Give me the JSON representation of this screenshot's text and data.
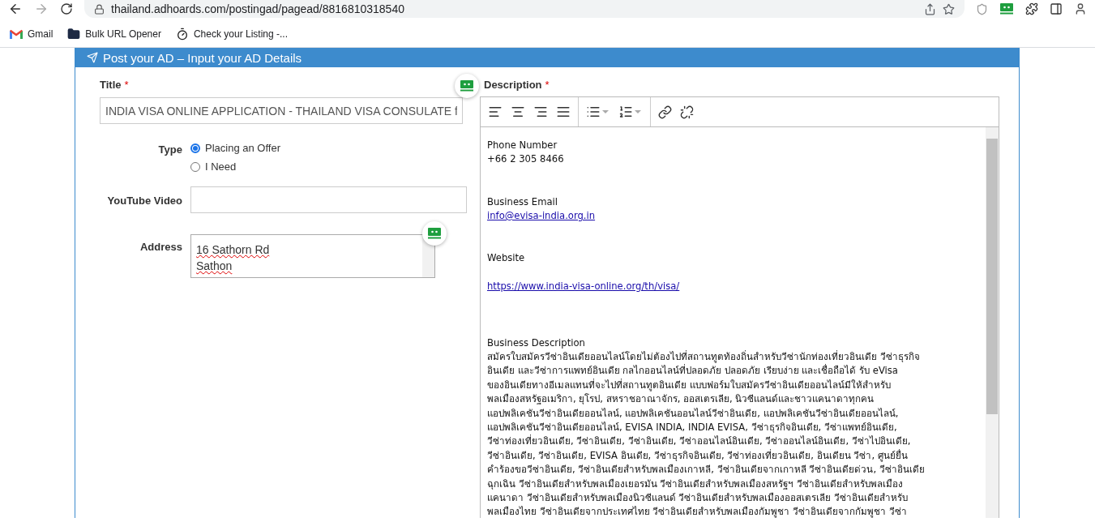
{
  "browser": {
    "url": "thailand.adhoards.com/postingad/pagead/8816810318540",
    "bookmarks": [
      {
        "kind": "gmail",
        "label": "Gmail"
      },
      {
        "kind": "folder",
        "label": "Bulk URL Opener"
      },
      {
        "kind": "timer",
        "label": "Check your Listing -..."
      }
    ]
  },
  "form": {
    "header": "Post your AD – Input your AD Details",
    "title": {
      "label": "Title",
      "required_mark": "*",
      "value": "INDIA VISA ONLINE APPLICATION - THAILAND VISA CONSULATE f"
    },
    "type": {
      "label": "Type",
      "options": [
        {
          "label": "Placing an Offer",
          "selected": true
        },
        {
          "label": "I Need",
          "selected": false
        }
      ]
    },
    "youtube": {
      "label": "YouTube Video"
    },
    "address": {
      "label": "Address",
      "lines": [
        "16 Sathorn Rd",
        "Sathon"
      ]
    },
    "description": {
      "label": "Description",
      "required_mark": "*",
      "content": [
        {
          "kind": "text",
          "text": "Phone Number"
        },
        {
          "kind": "text",
          "text": "+66 2 305 8466"
        },
        {
          "kind": "blank"
        },
        {
          "kind": "blank"
        },
        {
          "kind": "text",
          "text": "Business Email"
        },
        {
          "kind": "link",
          "text": "info@evisa-india.org.in"
        },
        {
          "kind": "blank"
        },
        {
          "kind": "blank"
        },
        {
          "kind": "text",
          "text": "Website"
        },
        {
          "kind": "blank"
        },
        {
          "kind": "link",
          "text": "https://www.india-visa-online.org/th/visa/"
        },
        {
          "kind": "blank"
        },
        {
          "kind": "blank"
        },
        {
          "kind": "blank"
        },
        {
          "kind": "text",
          "text": "Business Description"
        },
        {
          "kind": "text",
          "text": "สมัครใบสมัครวีซ่าอินเดียออนไลน์โดยไม่ต้องไปที่สถานทูตท้องถิ่นสำหรับวีซ่านักท่องเที่ยวอินเดีย วีซ่าธุรกิจ"
        },
        {
          "kind": "text",
          "text": "อินเดีย และวีซ่าการแพทย์อินเดีย กลไกออนไลน์ที่ปลอดภัย ปลอดภัย เรียบง่าย และเชื่อถือได้ รับ eVisa"
        },
        {
          "kind": "text",
          "text": "ของอินเดียทางอีเมลแทนที่จะไปที่สถานทูตอินเดีย แบบฟอร์มใบสมัครวีซ่าอินเดียออนไลน์มีให้สำหรับ"
        },
        {
          "kind": "text",
          "text": "พลเมืองสหรัฐอเมริกา, ยุโรป, สหราชอาณาจักร, ออสเตรเลีย, นิวซีแลนด์และชาวแคนาดาทุกคน"
        },
        {
          "kind": "text",
          "text": "แอปพลิเคชันวีซ่าอินเดียออนไลน์, แอปพลิเคชันออนไลน์วีซ่าอินเดีย, แอปพลิเคชันวีซ่าอินเดียออนไลน์,"
        },
        {
          "kind": "text",
          "text": "แอปพลิเคชันวีซ่าอินเดียออนไลน์, EVISA INDIA, INDIA EVISA, วีซ่าธุรกิจอินเดีย, วีซ่าแพทย์อินเดีย,"
        },
        {
          "kind": "text",
          "text": "วีซ่าท่องเที่ยวอินเดีย, วีซ่าอินเดีย, วีซ่าอินเดีย, วีซ่าออนไลน์อินเดีย, วีซ่าออนไลน์อินเดีย, วีซ่าไปอินเดีย,"
        },
        {
          "kind": "text",
          "text": "วีซ่าอินเดีย, วีซ่าอินเดีย, EVISA อินเดีย, วีซ่าธุรกิจอินเดีย, วีซ่าท่องเที่ยวอินเดีย, อินเดียน วีซ่า, ศูนย์ยื่น"
        },
        {
          "kind": "text",
          "text": "คำร้องขอวีซ่าอินเดีย, วีซ่าอินเดียสำหรับพลเมืองเกาหลี, วีซ่าอินเดียจากเกาหลี วีซ่าอินเดียด่วน, วีซ่าอินเดีย"
        },
        {
          "kind": "text",
          "text": "ฉุกเฉิน วีซ่าอินเดียสำหรับพลเมืองเยอรมัน วีซ่าอินเดียสำหรับพลเมืองสหรัฐฯ วีซ่าอินเดียสำหรับพลเมือง"
        },
        {
          "kind": "text",
          "text": "แคนาดา วีซ่าอินเดียสำหรับพลเมืองนิวซีแลนด์ วีซ่าอินเดียสำหรับพลเมืองออสเตรเลีย วีซ่าอินเดียสำหรับ"
        },
        {
          "kind": "text",
          "text": "พลเมืองไทย วีซ่าอินเดียจากประเทศไทย วีซ่าอินเดียสำหรับพลเมืองกัมพูชา วีซ่าอินเดียจากกัมพูชา วีซ่า"
        }
      ]
    }
  }
}
